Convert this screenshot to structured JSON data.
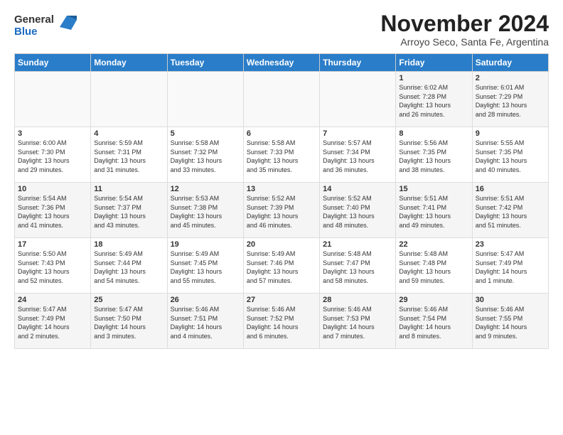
{
  "logo": {
    "general": "General",
    "blue": "Blue"
  },
  "header": {
    "month": "November 2024",
    "location": "Arroyo Seco, Santa Fe, Argentina"
  },
  "weekdays": [
    "Sunday",
    "Monday",
    "Tuesday",
    "Wednesday",
    "Thursday",
    "Friday",
    "Saturday"
  ],
  "weeks": [
    [
      {
        "num": "",
        "info": ""
      },
      {
        "num": "",
        "info": ""
      },
      {
        "num": "",
        "info": ""
      },
      {
        "num": "",
        "info": ""
      },
      {
        "num": "",
        "info": ""
      },
      {
        "num": "1",
        "info": "Sunrise: 6:02 AM\nSunset: 7:28 PM\nDaylight: 13 hours\nand 26 minutes."
      },
      {
        "num": "2",
        "info": "Sunrise: 6:01 AM\nSunset: 7:29 PM\nDaylight: 13 hours\nand 28 minutes."
      }
    ],
    [
      {
        "num": "3",
        "info": "Sunrise: 6:00 AM\nSunset: 7:30 PM\nDaylight: 13 hours\nand 29 minutes."
      },
      {
        "num": "4",
        "info": "Sunrise: 5:59 AM\nSunset: 7:31 PM\nDaylight: 13 hours\nand 31 minutes."
      },
      {
        "num": "5",
        "info": "Sunrise: 5:58 AM\nSunset: 7:32 PM\nDaylight: 13 hours\nand 33 minutes."
      },
      {
        "num": "6",
        "info": "Sunrise: 5:58 AM\nSunset: 7:33 PM\nDaylight: 13 hours\nand 35 minutes."
      },
      {
        "num": "7",
        "info": "Sunrise: 5:57 AM\nSunset: 7:34 PM\nDaylight: 13 hours\nand 36 minutes."
      },
      {
        "num": "8",
        "info": "Sunrise: 5:56 AM\nSunset: 7:35 PM\nDaylight: 13 hours\nand 38 minutes."
      },
      {
        "num": "9",
        "info": "Sunrise: 5:55 AM\nSunset: 7:35 PM\nDaylight: 13 hours\nand 40 minutes."
      }
    ],
    [
      {
        "num": "10",
        "info": "Sunrise: 5:54 AM\nSunset: 7:36 PM\nDaylight: 13 hours\nand 41 minutes."
      },
      {
        "num": "11",
        "info": "Sunrise: 5:54 AM\nSunset: 7:37 PM\nDaylight: 13 hours\nand 43 minutes."
      },
      {
        "num": "12",
        "info": "Sunrise: 5:53 AM\nSunset: 7:38 PM\nDaylight: 13 hours\nand 45 minutes."
      },
      {
        "num": "13",
        "info": "Sunrise: 5:52 AM\nSunset: 7:39 PM\nDaylight: 13 hours\nand 46 minutes."
      },
      {
        "num": "14",
        "info": "Sunrise: 5:52 AM\nSunset: 7:40 PM\nDaylight: 13 hours\nand 48 minutes."
      },
      {
        "num": "15",
        "info": "Sunrise: 5:51 AM\nSunset: 7:41 PM\nDaylight: 13 hours\nand 49 minutes."
      },
      {
        "num": "16",
        "info": "Sunrise: 5:51 AM\nSunset: 7:42 PM\nDaylight: 13 hours\nand 51 minutes."
      }
    ],
    [
      {
        "num": "17",
        "info": "Sunrise: 5:50 AM\nSunset: 7:43 PM\nDaylight: 13 hours\nand 52 minutes."
      },
      {
        "num": "18",
        "info": "Sunrise: 5:49 AM\nSunset: 7:44 PM\nDaylight: 13 hours\nand 54 minutes."
      },
      {
        "num": "19",
        "info": "Sunrise: 5:49 AM\nSunset: 7:45 PM\nDaylight: 13 hours\nand 55 minutes."
      },
      {
        "num": "20",
        "info": "Sunrise: 5:49 AM\nSunset: 7:46 PM\nDaylight: 13 hours\nand 57 minutes."
      },
      {
        "num": "21",
        "info": "Sunrise: 5:48 AM\nSunset: 7:47 PM\nDaylight: 13 hours\nand 58 minutes."
      },
      {
        "num": "22",
        "info": "Sunrise: 5:48 AM\nSunset: 7:48 PM\nDaylight: 13 hours\nand 59 minutes."
      },
      {
        "num": "23",
        "info": "Sunrise: 5:47 AM\nSunset: 7:49 PM\nDaylight: 14 hours\nand 1 minute."
      }
    ],
    [
      {
        "num": "24",
        "info": "Sunrise: 5:47 AM\nSunset: 7:49 PM\nDaylight: 14 hours\nand 2 minutes."
      },
      {
        "num": "25",
        "info": "Sunrise: 5:47 AM\nSunset: 7:50 PM\nDaylight: 14 hours\nand 3 minutes."
      },
      {
        "num": "26",
        "info": "Sunrise: 5:46 AM\nSunset: 7:51 PM\nDaylight: 14 hours\nand 4 minutes."
      },
      {
        "num": "27",
        "info": "Sunrise: 5:46 AM\nSunset: 7:52 PM\nDaylight: 14 hours\nand 6 minutes."
      },
      {
        "num": "28",
        "info": "Sunrise: 5:46 AM\nSunset: 7:53 PM\nDaylight: 14 hours\nand 7 minutes."
      },
      {
        "num": "29",
        "info": "Sunrise: 5:46 AM\nSunset: 7:54 PM\nDaylight: 14 hours\nand 8 minutes."
      },
      {
        "num": "30",
        "info": "Sunrise: 5:46 AM\nSunset: 7:55 PM\nDaylight: 14 hours\nand 9 minutes."
      }
    ]
  ]
}
